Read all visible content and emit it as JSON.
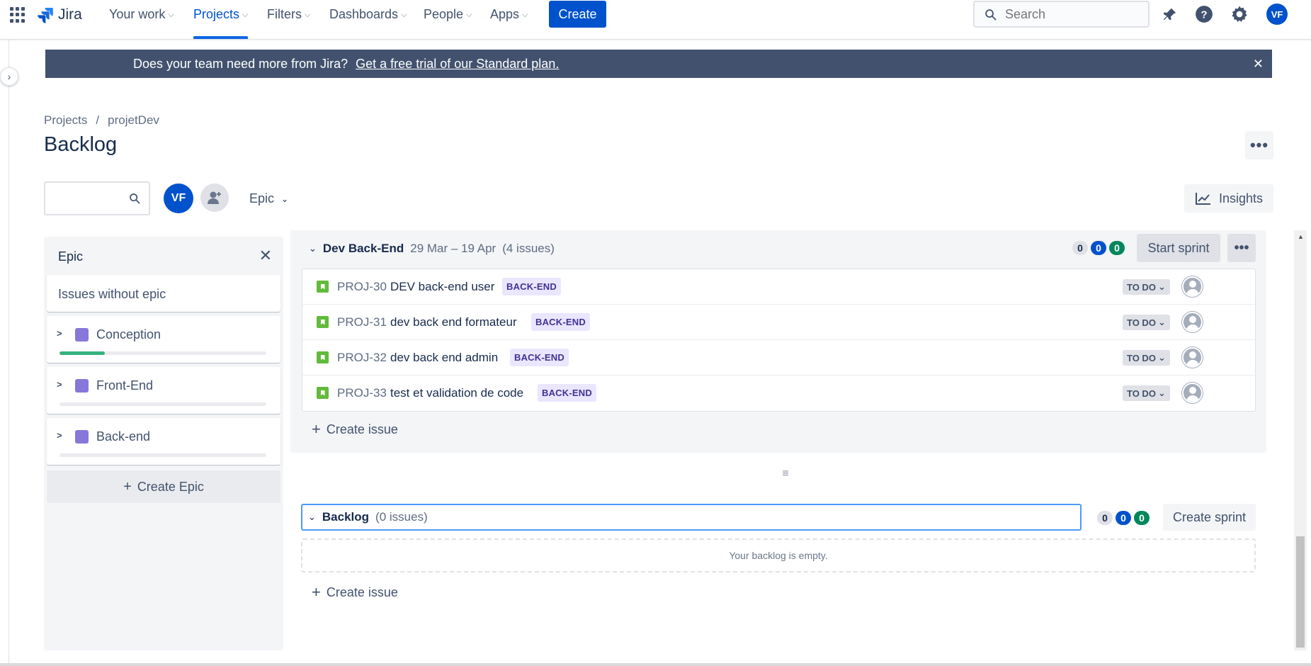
{
  "nav": {
    "logo_text": "Jira",
    "items": [
      {
        "label": "Your work"
      },
      {
        "label": "Projects"
      },
      {
        "label": "Filters"
      },
      {
        "label": "Dashboards"
      },
      {
        "label": "People"
      },
      {
        "label": "Apps"
      }
    ],
    "active_item": "Projects",
    "create_label": "Create",
    "search_placeholder": "Search",
    "avatar_initials": "VF"
  },
  "banner": {
    "message": "Does your team need more from Jira?",
    "link_text": "Get a free trial of our Standard plan."
  },
  "breadcrumb": [
    "Projects",
    "/",
    "projetDev"
  ],
  "page_title": "Backlog",
  "filters": {
    "avatar_initials": "VF",
    "epic_label": "Epic",
    "insights_label": "Insights"
  },
  "epic_panel": {
    "title": "Epic",
    "issues_without_epic": "Issues without epic",
    "epics": [
      {
        "name": "Conception",
        "progress": 0.22
      },
      {
        "name": "Front-End",
        "progress": 0
      },
      {
        "name": "Back-end",
        "progress": 0
      }
    ],
    "create_epic_label": "Create Epic"
  },
  "sprint": {
    "name": "Dev Back-End",
    "dates": "29 Mar – 19 Apr",
    "count": "(4 issues)",
    "counts": {
      "todo": "0",
      "in_progress": "0",
      "done": "0"
    },
    "start_label": "Start sprint",
    "issues": [
      {
        "key": "PROJ-30",
        "summary": "DEV back-end user",
        "epic": "BACK-END",
        "status": "TO DO"
      },
      {
        "key": "PROJ-31",
        "summary": "dev back end formateur",
        "epic": "BACK-END",
        "status": "TO DO"
      },
      {
        "key": "PROJ-32",
        "summary": "dev back end admin",
        "epic": "BACK-END",
        "status": "TO DO"
      },
      {
        "key": "PROJ-33",
        "summary": "test et validation de code",
        "epic": "BACK-END",
        "status": "TO DO"
      }
    ],
    "create_issue_label": "Create issue"
  },
  "backlog": {
    "name": "Backlog",
    "count": "(0 issues)",
    "counts": {
      "todo": "0",
      "in_progress": "0",
      "done": "0"
    },
    "create_sprint_label": "Create sprint",
    "empty_text": "Your backlog is empty.",
    "create_issue_label": "Create issue"
  },
  "colors": {
    "primary": "#0052cc",
    "banner_bg": "#42526e",
    "epic_color": "#8777d9",
    "story_icon": "#63ba3c",
    "done_green": "#00875a"
  }
}
